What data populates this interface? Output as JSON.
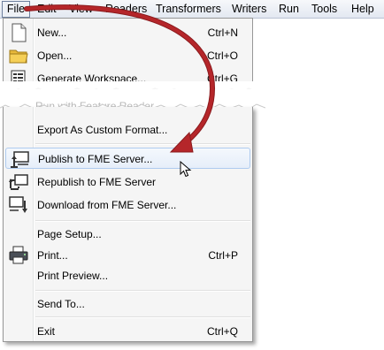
{
  "menubar": {
    "items": [
      {
        "label": "File",
        "x": 0
      },
      {
        "label": "Edit"
      },
      {
        "label": "View"
      },
      {
        "label": "Readers"
      },
      {
        "label": "Transformers"
      },
      {
        "label": "Writers"
      },
      {
        "label": "Run"
      },
      {
        "label": "Tools"
      },
      {
        "label": "Help"
      }
    ]
  },
  "menu": {
    "new": {
      "label": "New...",
      "shortcut": "Ctrl+N",
      "icon": "new-document-icon"
    },
    "open": {
      "label": "Open...",
      "shortcut": "Ctrl+O",
      "icon": "folder-icon"
    },
    "generate": {
      "label": "Generate Workspace...",
      "shortcut": "Ctrl+G",
      "icon": "workspace-icon"
    },
    "hidden_partial": "Run with Feature Reader...",
    "export_custom": {
      "label": "Export As Custom Format..."
    },
    "publish": {
      "label": "Publish to FME Server...",
      "icon": "publish-server-icon"
    },
    "republish": {
      "label": "Republish to FME Server",
      "icon": "republish-server-icon"
    },
    "download": {
      "label": "Download from FME Server...",
      "icon": "download-server-icon"
    },
    "page_setup": {
      "label": "Page Setup..."
    },
    "print": {
      "label": "Print...",
      "shortcut": "Ctrl+P",
      "icon": "printer-icon"
    },
    "print_preview": {
      "label": "Print Preview..."
    },
    "send_to": {
      "label": "Send To..."
    },
    "exit": {
      "label": "Exit",
      "shortcut": "Ctrl+Q"
    }
  },
  "colors": {
    "arrow": "#b5262a",
    "highlight_border": "#aecbef"
  }
}
